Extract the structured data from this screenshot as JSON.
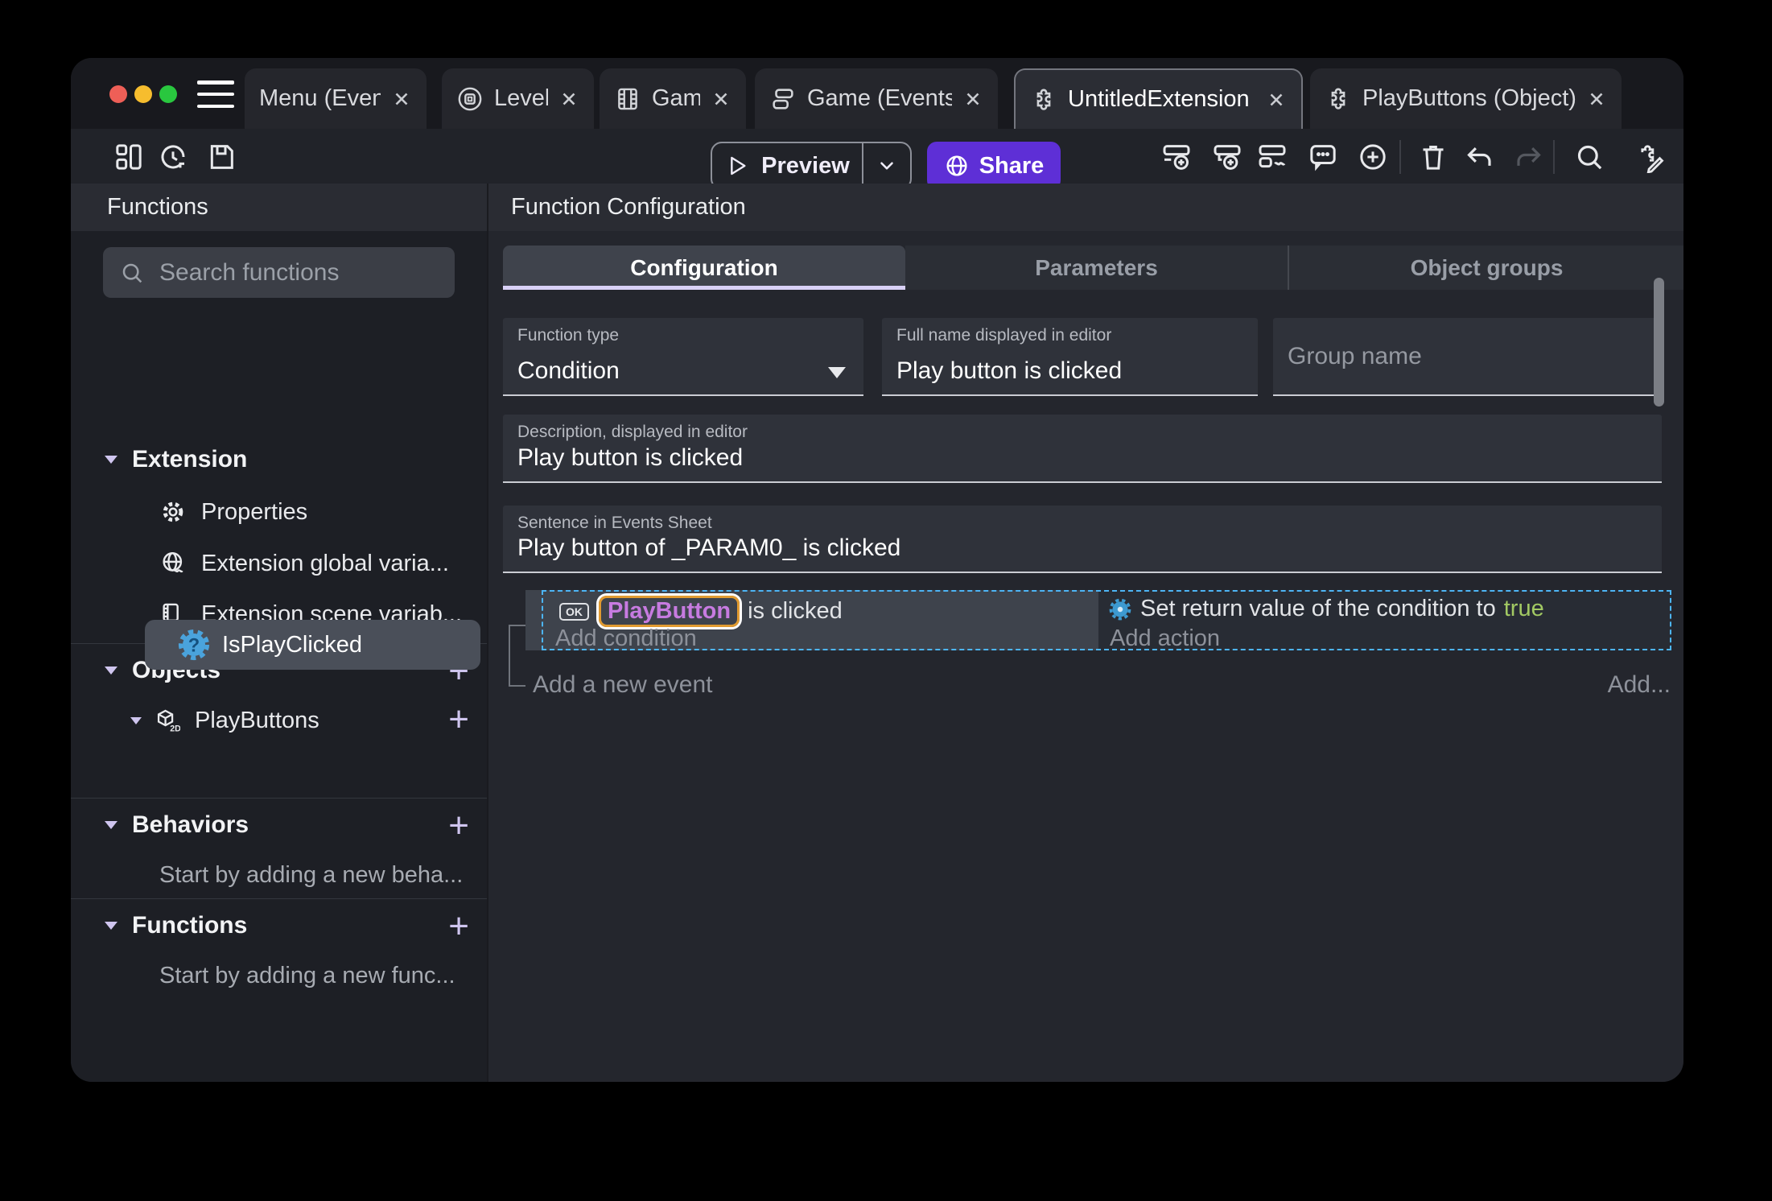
{
  "window": {
    "traffic_red": "#ee5f57",
    "traffic_yellow": "#f6bd2e",
    "traffic_green": "#29c73f"
  },
  "tabbar": {
    "tabs": [
      {
        "label": "Menu (Events)",
        "icon": "none"
      },
      {
        "label": "Level",
        "icon": "scene-icon"
      },
      {
        "label": "Game",
        "icon": "film-icon"
      },
      {
        "label": "Game (Events)",
        "icon": "events-icon"
      },
      {
        "label": "UntitledExtension",
        "icon": "puzzle-icon",
        "active": true
      },
      {
        "label": "PlayButtons (Object)",
        "icon": "puzzle-icon"
      }
    ]
  },
  "toolbar": {
    "preview_label": "Preview",
    "share_label": "Share"
  },
  "sidebar": {
    "title": "Functions",
    "search_placeholder": "Search functions",
    "extension_label": "Extension",
    "properties_label": "Properties",
    "global_vars_label": "Extension global varia...",
    "scene_vars_label": "Extension scene variab...",
    "objects_label": "Objects",
    "playbuttons_label": "PlayButtons",
    "isplayclicked_label": "IsPlayClicked",
    "behaviors_label": "Behaviors",
    "behaviors_hint": "Start by adding a new beha...",
    "functions_label": "Functions",
    "functions_hint": "Start by adding a new func..."
  },
  "main": {
    "header": "Function Configuration",
    "tabs": {
      "configuration": "Configuration",
      "parameters": "Parameters",
      "object_groups": "Object groups"
    },
    "fields": {
      "function_type_label": "Function type",
      "function_type_value": "Condition",
      "full_name_label": "Full name displayed in editor",
      "full_name_value": "Play button is clicked",
      "group_name_placeholder": "Group name",
      "description_label": "Description, displayed in editor",
      "description_value": "Play button is clicked",
      "sentence_label": "Sentence in Events Sheet",
      "sentence_value": "Play button of _PARAM0_ is clicked"
    },
    "events": {
      "condition_ok": "OK",
      "condition_object": "PlayButton",
      "condition_text": "is clicked",
      "add_condition": "Add condition",
      "action_text": "Set return value of the condition to",
      "action_value": "true",
      "add_action": "Add action",
      "add_new_event": "Add a new event",
      "add_more": "Add..."
    }
  },
  "colors": {
    "accent_purple": "#5e2fd6",
    "selection_blue": "#4db5f5",
    "object_violet": "#c77be0",
    "highlight_orange": "#e19b31",
    "boolean_green": "#a2c963"
  }
}
